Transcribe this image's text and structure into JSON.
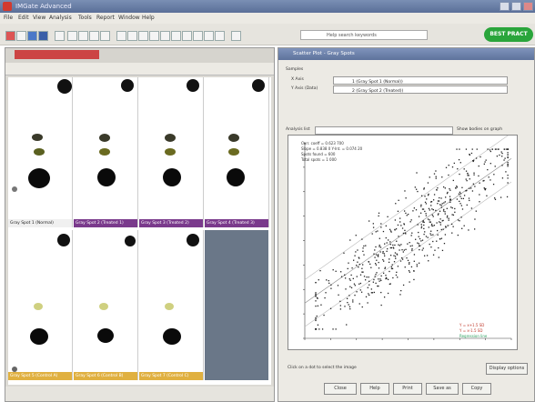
{
  "app": {
    "title": "IMGate Advanced",
    "quick_button": "BEST PRACT"
  },
  "menu": [
    "File",
    "Edit",
    "View",
    "Analysis",
    "Tools",
    "Report",
    "Window",
    "Help"
  ],
  "toolbar": {
    "search_text": "Help search keywords"
  },
  "left_window": {
    "tile_labels": [
      "Gray Spot 1 (Normal)",
      "Gray Spot 2 (Treated 1)",
      "Gray Spot 3 (Treated 2)",
      "Gray Spot 4 (Treated 3)",
      "Gray Spot 5 (Control A)",
      "Gray Spot 6 (Control B)",
      "Gray Spot 7 (Control C)"
    ]
  },
  "right_window": {
    "title": "Scatter Plot - Gray Spots",
    "group_label": "Samples",
    "x_label": "X Axis",
    "y_label": "Y Axis (Data)",
    "x_value": "1 (Gray Spot 1 (Normal))",
    "y_value": "2 (Gray Spot 2 (Treated))",
    "search_label": "Analysis list",
    "checkbox_label": "Show bodies on graph",
    "stats": [
      "Corr. coeff = 0.623 700",
      "Slope = 0.838 0  Y-Int. = 0.074 20",
      "Spots found = 600",
      "Total spots = 1 000"
    ],
    "legend": [
      "Y = x+1.5 SD",
      "Y = x-1.5 SD",
      "Regression line"
    ],
    "footer_checkbox": "Click on a dot to select the image",
    "footer_button": "Display options",
    "buttons": [
      "Close",
      "Help",
      "Print",
      "Save as",
      "Copy"
    ],
    "colors": {
      "legend1": "#c0392b",
      "legend2": "#c0392b",
      "legend3": "#2a9d5c"
    }
  },
  "chart_data": {
    "type": "scatter",
    "title": "",
    "xlabel": "",
    "ylabel": "",
    "series": [
      {
        "points": "random cloud along diagonal (approx. 600 points)"
      }
    ]
  }
}
